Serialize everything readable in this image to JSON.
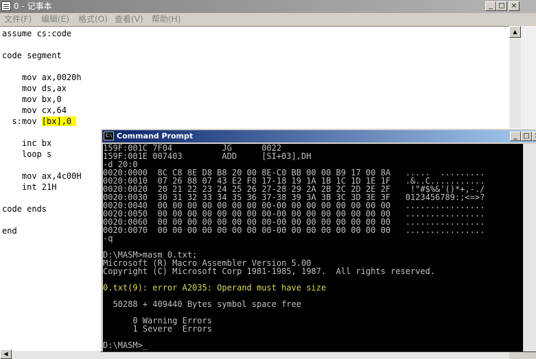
{
  "notepad": {
    "title": "0 - 记事本",
    "menu": [
      "文件(F)",
      "编辑(E)",
      "格式(O)",
      "查看(V)",
      "帮助(H)"
    ],
    "lines_before": "assume cs:code\n\ncode segment\n\n    mov ax,0020h\n    mov ds,ax\n    mov bx,0\n    mov cx,64\n  s:mov ",
    "highlight": "[bx],0 ",
    "lines_after": "\n\n    inc bx\n    loop s\n\n    mov ax,4c00H\n    int 21H\n\ncode ends\n\nend"
  },
  "cmd": {
    "title": "Command Prompt",
    "text_before": "159F:001C 7F04          JG      0022\n159F:001E 007403        ADD     [SI+03],DH\n-d 20:0\n0020:0000  8C C8 8E D8 B8 20 00 8E-C0 BB 00 00 B9 17 00 8A   .....  .........\n0020:0010  07 26 88 07 43 E2 F8 17-18 19 1A 1B 1C 1D 1E 1F   .&..C...........\n0020:0020  20 21 22 23 24 25 26 27-28 29 2A 2B 2C 2D 2E 2F    !\"#$%&'()*+,-./\n0020:0030  30 31 32 33 34 35 36 37-38 39 3A 3B 3C 3D 3E 3F   0123456789:;<=>?\n0020:0040  00 00 00 00 00 00 00 00-00 00 00 00 00 00 00 00   ................\n0020:0050  00 00 00 00 00 00 00 00-00 00 00 00 00 00 00 00   ................\n0020:0060  00 00 00 00 00 00 00 00-00 00 00 00 00 00 00 00   ................\n0020:0070  00 00 00 00 00 00 00 00-00 00 00 00 00 00 00 00   ................\n-q\n\nD:\\MASM>masm 0.txt;\nMicrosoft (R) Macro Assembler Version 5.00\nCopyright (C) Microsoft Corp 1981-1985, 1987.  All rights reserved.\n\n",
    "error_line": "0.txt(9): error A2035: Operand must have size",
    "text_after": "\n\n  50288 + 409440 Bytes symbol space free\n\n      0 Warning Errors\n      1 Severe  Errors\n\nD:\\MASM>_"
  }
}
